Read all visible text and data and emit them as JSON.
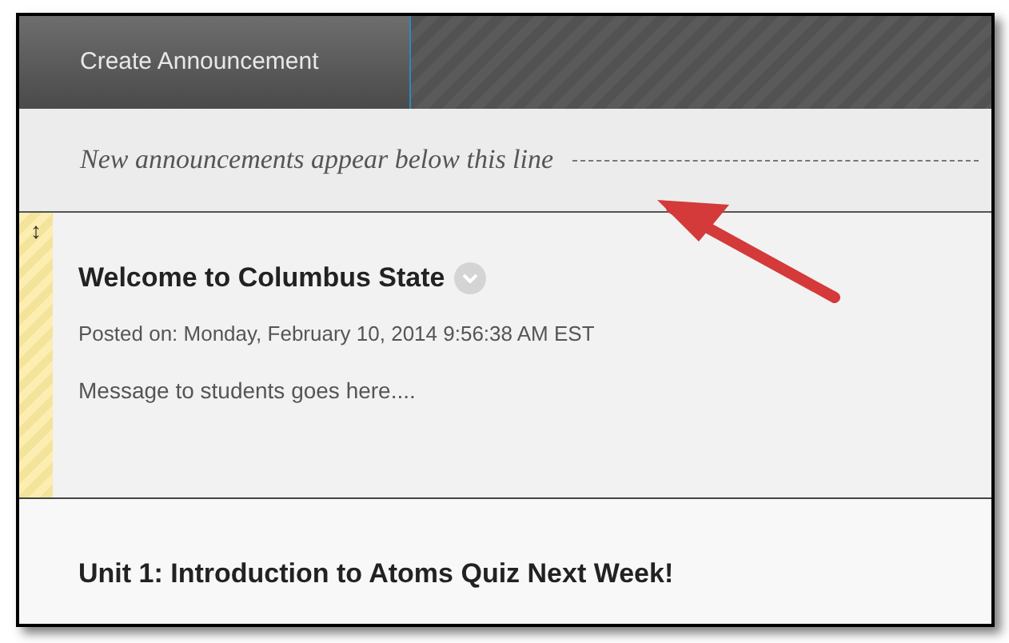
{
  "toolbar": {
    "button": "Create Announcement"
  },
  "divider": {
    "text": "New announcements appear below this line"
  },
  "announcements": [
    {
      "title": "Welcome to Columbus State",
      "hovered": true,
      "handle": "↕",
      "posted": "Posted on: Monday, February 10, 2014 9:56:38 AM EST",
      "message": "Message to students goes here...."
    },
    {
      "title": "Unit 1: Introduction to Atoms Quiz Next Week!",
      "hovered": false
    }
  ]
}
